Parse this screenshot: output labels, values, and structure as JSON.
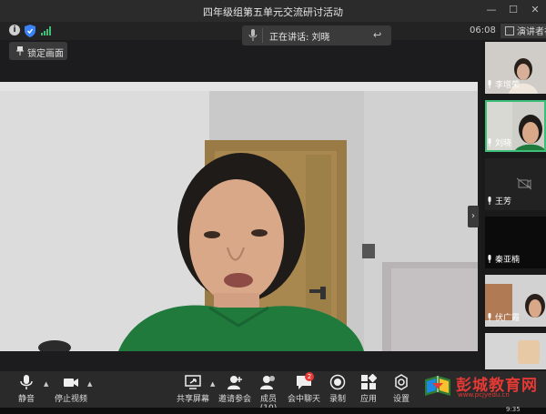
{
  "window": {
    "title": "四年级组第五单元交流研讨活动",
    "minimize": "—",
    "maximize": "☐",
    "close": "✕"
  },
  "topbar": {
    "speaker_text": "正在讲话: 刘晓",
    "time": "06:08",
    "presenter_label": "演讲者视"
  },
  "lock_button": {
    "label": "锁定画面"
  },
  "participants": [
    {
      "name": "李增荣",
      "muted": false
    },
    {
      "name": "刘晓",
      "muted": false,
      "active": true
    },
    {
      "name": "王芳",
      "muted": false,
      "video_off": true
    },
    {
      "name": "秦亚楠",
      "muted": false
    },
    {
      "name": "伏广霞",
      "muted": false
    }
  ],
  "toolbar": {
    "mute": "静音",
    "stop_video": "停止视频",
    "share": "共享屏幕",
    "invite": "邀请参会",
    "members": "成员(10)",
    "chat": "会中聊天",
    "chat_badge": "2",
    "record": "录制",
    "apps": "应用",
    "settings": "设置"
  },
  "logo": {
    "name": "彭城教育网",
    "url": "www.pcjyedu.cn"
  },
  "taskbar": {
    "clock": "9:35"
  },
  "colors": {
    "active_border": "#3dbf7a",
    "badge": "#e53935",
    "brand": "#e53935"
  }
}
